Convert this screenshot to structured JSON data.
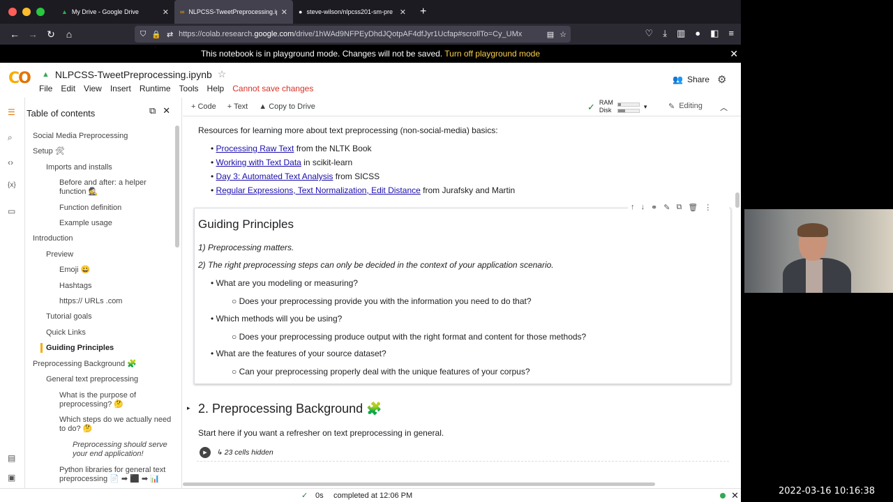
{
  "tabs": [
    {
      "title": "My Drive - Google Drive",
      "active": false
    },
    {
      "title": "NLPCSS-TweetPreprocessing.ip",
      "active": true
    },
    {
      "title": "steve-wilson/nlpcss201-sm-pre",
      "active": false
    }
  ],
  "address": {
    "prefix": "https://colab.research.",
    "domain": "google.com",
    "rest": "/drive/1hWAd9NFPEyDhdJQotpAF4dfJyr1Ucfap#scrollTo=Cy_UMx"
  },
  "banner": {
    "text": "This notebook is in playground mode. Changes will not be saved.",
    "link": "Turn off playground mode"
  },
  "header": {
    "title": "NLPCSS-TweetPreprocessing.ipynb",
    "menus": [
      "File",
      "Edit",
      "View",
      "Insert",
      "Runtime",
      "Tools",
      "Help"
    ],
    "warning": "Cannot save changes",
    "share": "Share"
  },
  "toolbar": {
    "code": "+ Code",
    "text": "+ Text",
    "copy": "Copy to Drive",
    "ram": "RAM",
    "disk": "Disk",
    "ram_fill": 0.15,
    "disk_fill": 0.35,
    "editing": "Editing"
  },
  "toc": {
    "title": "Table of contents",
    "items": [
      "Social Media Preprocessing",
      "Setup 🛠",
      "Imports and installs",
      "Before and after: a helper",
      "function 🕵",
      "Function definition",
      "Example usage",
      "Introduction",
      "Preview",
      "Emoji 😀",
      "Hashtags",
      "https:// URLs .com",
      "Tutorial goals",
      "Quick Links",
      "Guiding Principles",
      "Preprocessing Background 🧩",
      "General text preprocessing",
      "What is the purpose of",
      "preprocessing? 🤔",
      "Which steps do we actually need",
      "to do? 🤔",
      "Preprocessing should serve",
      "your end application!",
      "Python libraries for general text",
      "preprocessing 📄 ➡ ⬛ ➡ 📊"
    ]
  },
  "content": {
    "resources": "Resources for learning more about text preprocessing (non-social-media) basics:",
    "links": [
      {
        "link": "Processing Raw Text",
        "after": " from the NLTK Book"
      },
      {
        "link": "Working with Text Data",
        "after": " in scikit-learn"
      },
      {
        "link": "Day 3: Automated Text Analysis",
        "after": " from SICSS"
      },
      {
        "link": "Regular Expressions, Text Normalization, Edit Distance",
        "after": " from Jurafsky and Martin"
      }
    ],
    "gp_title": "Guiding Principles",
    "p1": "1) Preprocessing matters.",
    "p2": "2) The right preprocessing steps can only be decided in the context of your application scenario.",
    "q1": "What are you modeling or measuring?",
    "q1a": "Does your preprocessing provide you with the information you need to do that?",
    "q2": "Which methods will you be using?",
    "q2a": "Does your preprocessing produce output with the right format and content for those methods?",
    "q3": "What are the features of your source dataset?",
    "q3a": "Can your preprocessing properly deal with the unique features of your corpus?",
    "sec2": "2. Preprocessing Background 🧩",
    "sec2_desc": "Start here if you want a refresher on text preprocessing in general.",
    "hidden": "↳ 23 cells hidden"
  },
  "status": {
    "seconds": "0s",
    "completed": "completed at 12:06 PM"
  },
  "clock": "2022-03-16 10:16:38"
}
